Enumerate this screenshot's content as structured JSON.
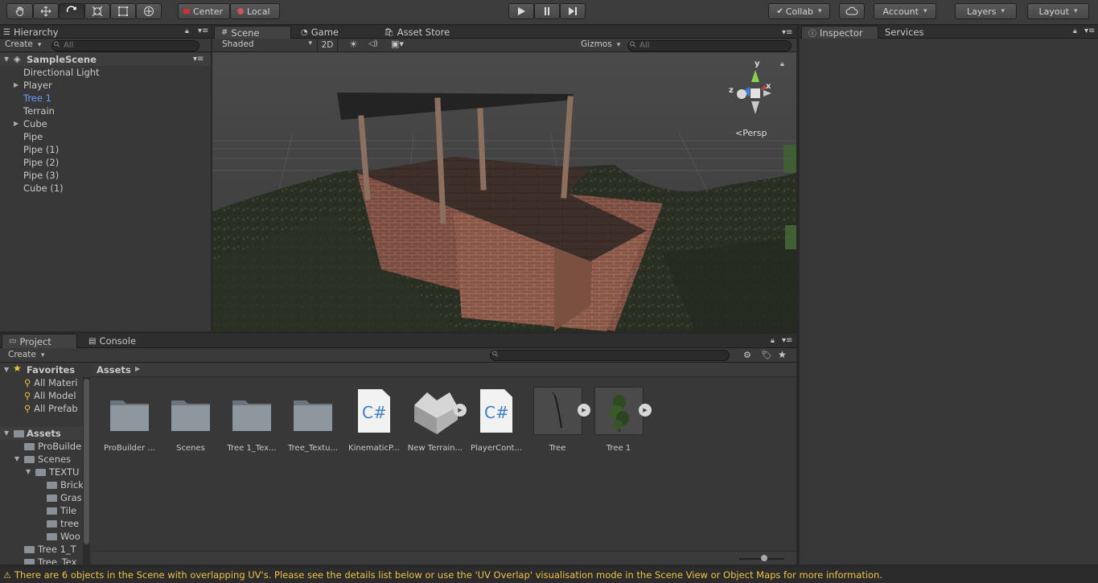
{
  "toolbar": {
    "pivot_label": "Center",
    "space_label": "Local",
    "collab_label": "Collab",
    "account_label": "Account",
    "layers_label": "Layers",
    "layout_label": "Layout"
  },
  "hierarchy": {
    "tab": "Hierarchy",
    "create": "Create",
    "search_placeholder": "All",
    "scene_name": "SampleScene",
    "items": [
      {
        "label": "Directional Light"
      },
      {
        "label": "Player"
      },
      {
        "label": "Tree 1"
      },
      {
        "label": "Terrain"
      },
      {
        "label": "Cube"
      },
      {
        "label": "Pipe"
      },
      {
        "label": "Pipe (1)"
      },
      {
        "label": "Pipe (2)"
      },
      {
        "label": "Pipe (3)"
      },
      {
        "label": "Cube (1)"
      }
    ],
    "selected_color": "#6b9bff"
  },
  "scene_view": {
    "tabs": [
      "Scene",
      "Game",
      "Asset Store"
    ],
    "shading": "Shaded",
    "mode_2d": "2D",
    "gizmos": "Gizmos",
    "search_placeholder": "All",
    "projection": "Persp",
    "axis_y": "y",
    "axis_x": "x",
    "axis_z": "z"
  },
  "inspector": {
    "tabs": [
      "Inspector",
      "Services"
    ]
  },
  "project": {
    "tabs": [
      "Project",
      "Console"
    ],
    "create": "Create",
    "breadcrumb": "Assets",
    "favorites": {
      "title": "Favorites",
      "items": [
        "All Materi",
        "All Model",
        "All Prefab"
      ]
    },
    "tree": {
      "root": "Assets",
      "items": [
        "ProBuilde",
        "Scenes",
        "TEXTU",
        "Brick",
        "Gras",
        "Tile",
        "tree",
        "Woo",
        "Tree 1_T",
        "Tree_Tex"
      ]
    },
    "assets": [
      {
        "label": "ProBuilder ...",
        "kind": "folder"
      },
      {
        "label": "Scenes",
        "kind": "folder"
      },
      {
        "label": "Tree 1_Tex...",
        "kind": "folder"
      },
      {
        "label": "Tree_Textu...",
        "kind": "folder"
      },
      {
        "label": "KinematicP...",
        "kind": "script"
      },
      {
        "label": "New Terrain...",
        "kind": "terrain"
      },
      {
        "label": "PlayerCont...",
        "kind": "script"
      },
      {
        "label": "Tree",
        "kind": "prefab"
      },
      {
        "label": "Tree 1",
        "kind": "prefab"
      }
    ],
    "script_glyph": "C#"
  },
  "status": {
    "message": "There are 6 objects in the Scene with overlapping UV's. Please see the details list below or use the 'UV Overlap' visualisation mode in the Scene View or Object Maps for more information.",
    "color": "#f0c24a"
  }
}
